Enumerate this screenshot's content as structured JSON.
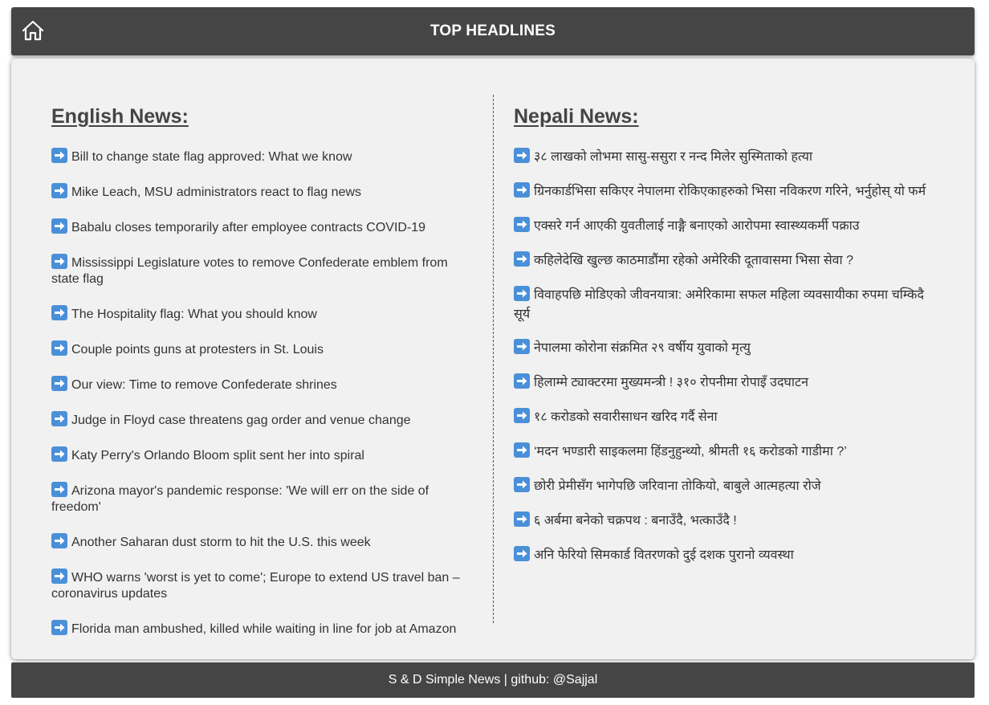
{
  "header": {
    "title": "TOP HEADLINES",
    "home_icon": "home-icon"
  },
  "english": {
    "title": "English News:",
    "items": [
      "Bill to change state flag approved: What we know",
      "Mike Leach, MSU administrators react to flag news",
      "Babalu closes temporarily after employee contracts COVID-19",
      "Mississippi Legislature votes to remove Confederate emblem from state flag",
      "The Hospitality flag: What you should know",
      "Couple points guns at protesters in St. Louis",
      "Our view: Time to remove Confederate shrines",
      "Judge in Floyd case threatens gag order and venue change",
      "Katy Perry's Orlando Bloom split sent her into spiral",
      "Arizona mayor's pandemic response: 'We will err on the side of freedom'",
      "Another Saharan dust storm to hit the U.S. this week",
      "WHO warns 'worst is yet to come'; Europe to extend US travel ban – coronavirus updates",
      "Florida man ambushed, killed while waiting in line for job at Amazon"
    ]
  },
  "nepali": {
    "title": "Nepali News:",
    "items": [
      "३८ लाखको लोभमा सासु-ससुरा र नन्द मिलेर सुस्मिताको हत्या",
      "ग्रिनकार्डभिसा सकिएर नेपालमा रोकिएकाहरुको भिसा नविकरण गरिने, भर्नुहोस् यो फर्म",
      "एक्सरे गर्न आएकी युवतीलाई नाङ्गै बनाएको आरोपमा स्वास्थ्यकर्मी पक्राउ",
      "कहिलेदेखि खुल्छ काठमाडौंमा रहेको अमेरिकी दूतावासमा भिसा सेवा ?",
      "विवाहपछि मोडिएको जीवनयात्रा: अमेरिकामा सफल महिला व्यवसायीका रुपमा चम्किदै सूर्य",
      "नेपालमा कोरोना संक्रमित २९ वर्षीय युवाको मृत्यु",
      "हिलाम्मे ट्याक्टरमा मुख्यमन्त्री ! ३१० रोपनीमा रोपाइँ उदघाटन",
      "१८ करोडको सवारीसाधन खरिद गर्दै सेना",
      "‘मदन भण्डारी साइकलमा हिंडनुहुन्थ्यो, श्रीमती १६ करोडको गाडीमा ?’",
      "छोरी प्रेमीसँग भागेपछि जरिवाना तोकियो, बाबुले आत्महत्या रोजे",
      "६ अर्बमा बनेको चक्रपथ : बनाउँदै, भत्काउँदै !",
      "अनि फेरियो सिमकार्ड वितरणको दुई दशक पुरानो व्यवस्था"
    ]
  },
  "footer": {
    "text": "S & D Simple News | github: @Sajjal"
  },
  "colors": {
    "bar": "#454545",
    "card": "#f1f1f1",
    "arrow": "#4a90d9"
  }
}
